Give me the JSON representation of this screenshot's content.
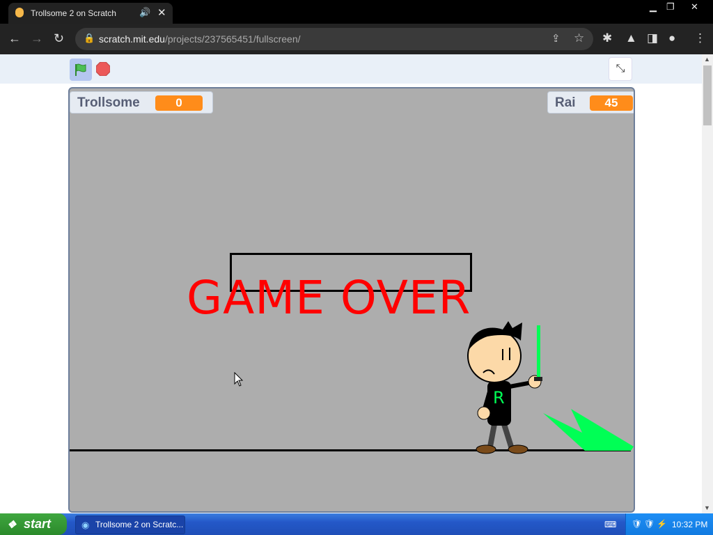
{
  "browser": {
    "tab_title": "Trollsome 2 on Scratch",
    "url_host": "scratch.mit.edu",
    "url_path": "/projects/237565451/fullscreen/"
  },
  "stage": {
    "variables": [
      {
        "name": "Trollsome",
        "value": "0"
      },
      {
        "name": "Rai",
        "value": "45"
      }
    ],
    "game_over_text": "GAME OVER",
    "sprite_letter": "R"
  },
  "taskbar": {
    "start_label": "start",
    "task_label": "Trollsome 2 on Scratc...",
    "clock": "10:32 PM"
  },
  "colors": {
    "accent_orange": "#ff8c1a",
    "game_over_red": "#ff0000",
    "saber_green": "#00ff55"
  }
}
